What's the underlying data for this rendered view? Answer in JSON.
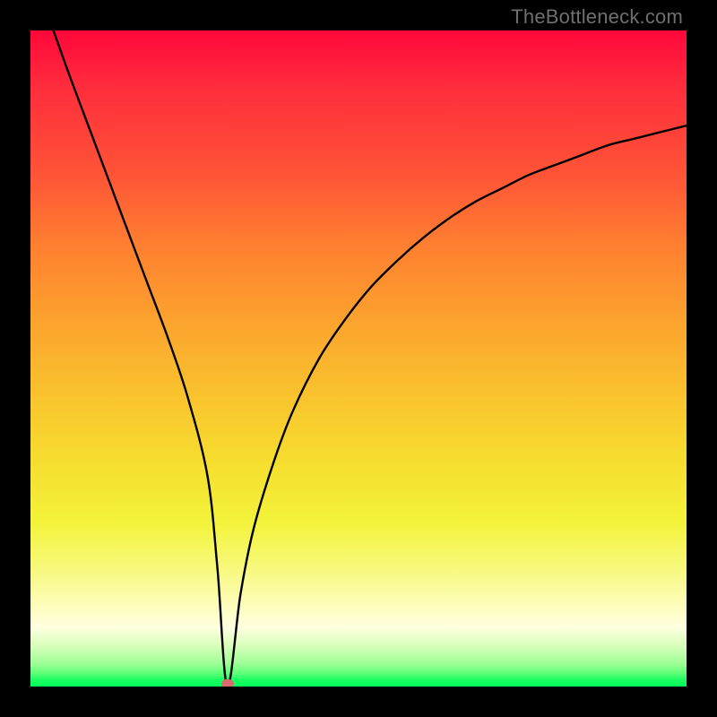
{
  "watermark": "TheBottleneck.com",
  "colors": {
    "background": "#000000",
    "curve": "#000000",
    "marker": "#d96d6d"
  },
  "chart_data": {
    "type": "line",
    "title": "",
    "xlabel": "",
    "ylabel": "",
    "xlim": [
      0,
      100
    ],
    "ylim": [
      0,
      100
    ],
    "grid": false,
    "series": [
      {
        "name": "bottleneck-curve",
        "x": [
          3.5,
          6,
          9,
          12,
          15,
          18,
          21,
          24,
          27,
          28.5,
          30,
          32,
          34,
          37,
          40,
          44,
          48,
          52,
          56,
          60,
          64,
          68,
          72,
          76,
          80,
          84,
          88,
          92,
          96,
          100
        ],
        "y": [
          100,
          93,
          85,
          77,
          69,
          61,
          53,
          44,
          32,
          18,
          0,
          14,
          24,
          34,
          42,
          50,
          56,
          61,
          65,
          68.5,
          71.5,
          74,
          76,
          78,
          79.5,
          81,
          82.5,
          83.5,
          84.5,
          85.5
        ]
      }
    ],
    "annotations": [
      {
        "name": "min-marker",
        "x": 30,
        "y": 0
      }
    ]
  }
}
